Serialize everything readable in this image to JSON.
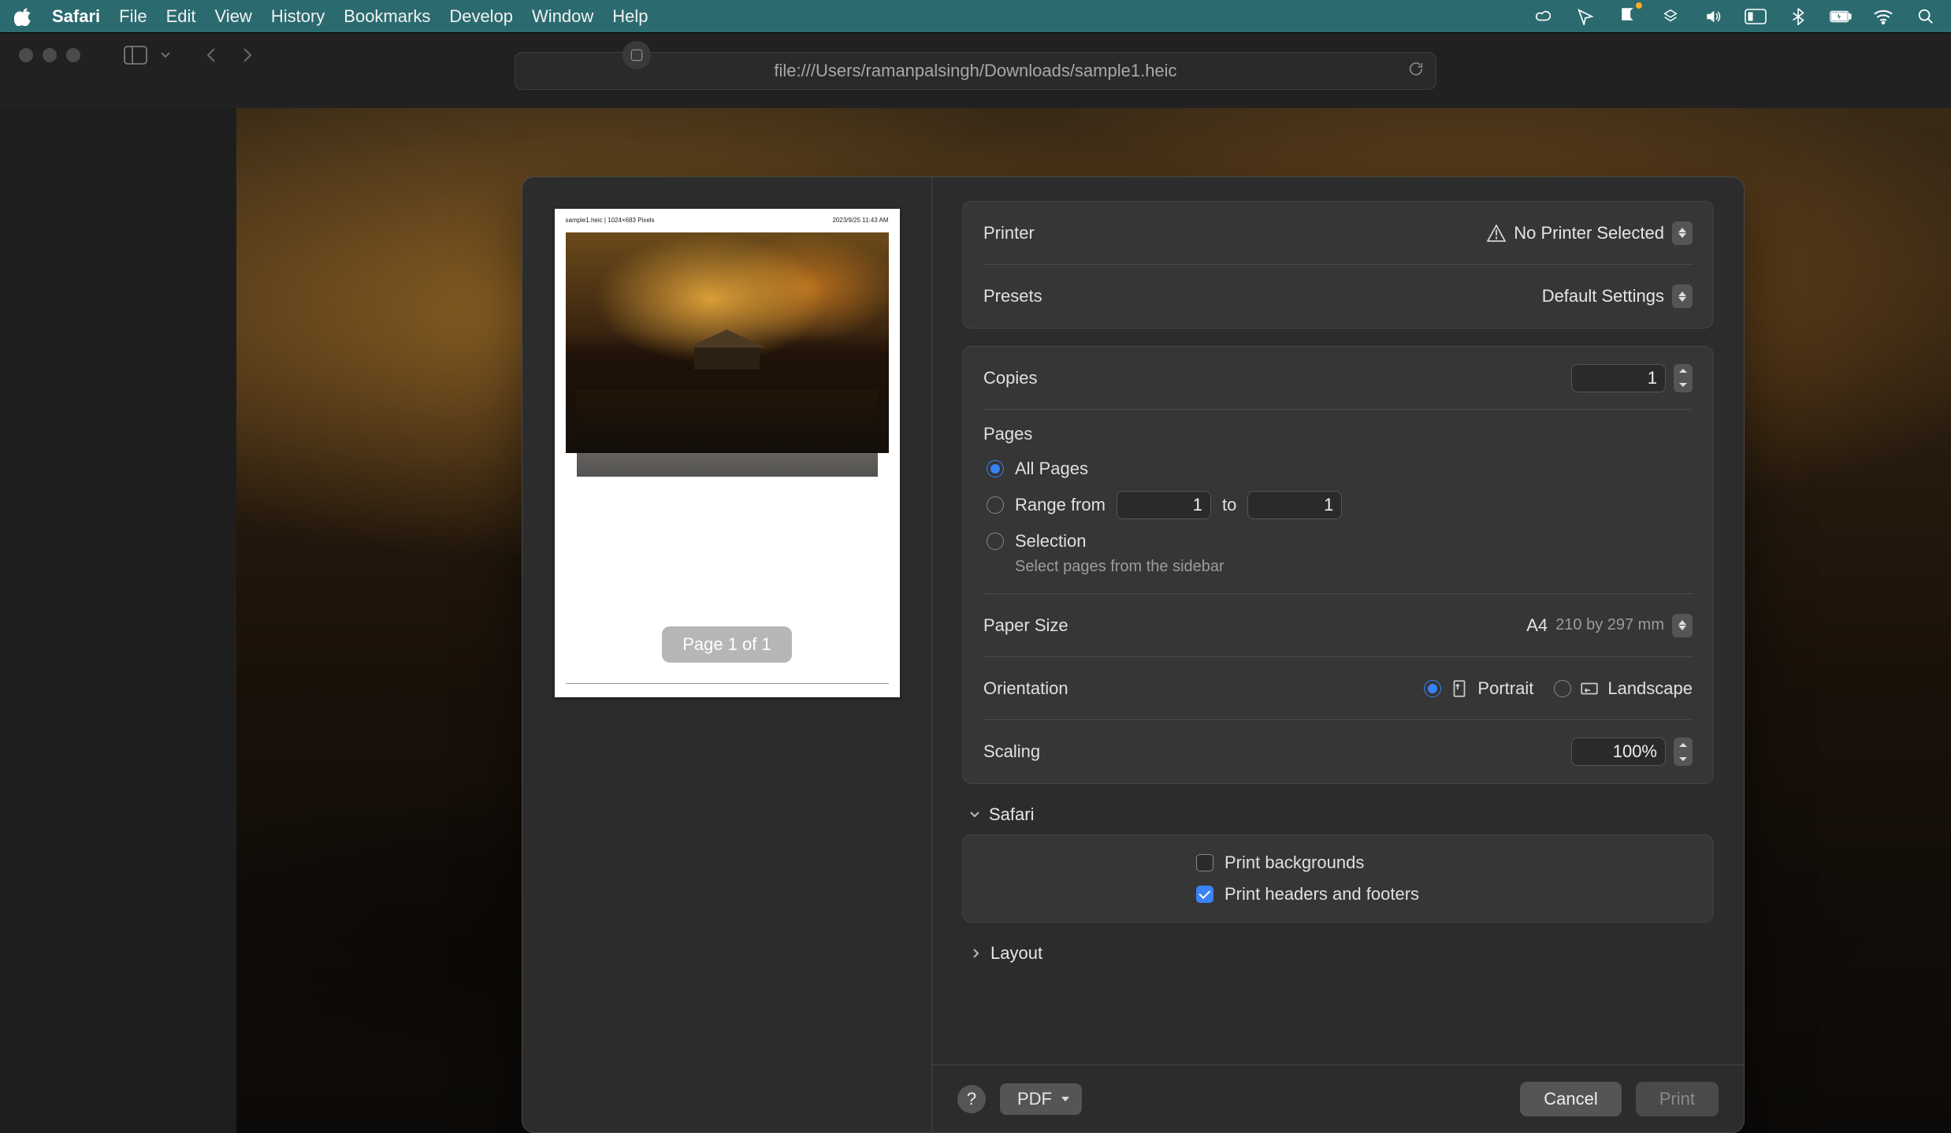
{
  "menubar": {
    "app": "Safari",
    "items": [
      "File",
      "Edit",
      "View",
      "History",
      "Bookmarks",
      "Develop",
      "Window",
      "Help"
    ]
  },
  "urlbar": {
    "url": "file:///Users/ramanpalsingh/Downloads/sample1.heic"
  },
  "preview": {
    "page_counter": "Page 1 of 1",
    "header_left": "sample1.heic | 1024×683 Pixels",
    "header_right": "2023/9/25 11:43 AM"
  },
  "print": {
    "printer_label": "Printer",
    "printer_value": "No Printer Selected",
    "presets_label": "Presets",
    "presets_value": "Default Settings",
    "copies_label": "Copies",
    "copies_value": "1",
    "pages_label": "Pages",
    "pages_all": "All Pages",
    "pages_range_prefix": "Range from",
    "pages_range_from": "1",
    "pages_range_to_word": "to",
    "pages_range_to": "1",
    "pages_selection": "Selection",
    "pages_selection_hint": "Select pages from the sidebar",
    "paper_label": "Paper Size",
    "paper_value": "A4",
    "paper_dims": "210 by 297 mm",
    "orient_label": "Orientation",
    "orient_portrait": "Portrait",
    "orient_landscape": "Landscape",
    "scaling_label": "Scaling",
    "scaling_value": "100%"
  },
  "safari_section": {
    "title": "Safari",
    "print_backgrounds": "Print backgrounds",
    "print_headers": "Print headers and footers"
  },
  "layout_section": {
    "title": "Layout"
  },
  "footer": {
    "pdf": "PDF",
    "cancel": "Cancel",
    "print": "Print",
    "help": "?"
  }
}
